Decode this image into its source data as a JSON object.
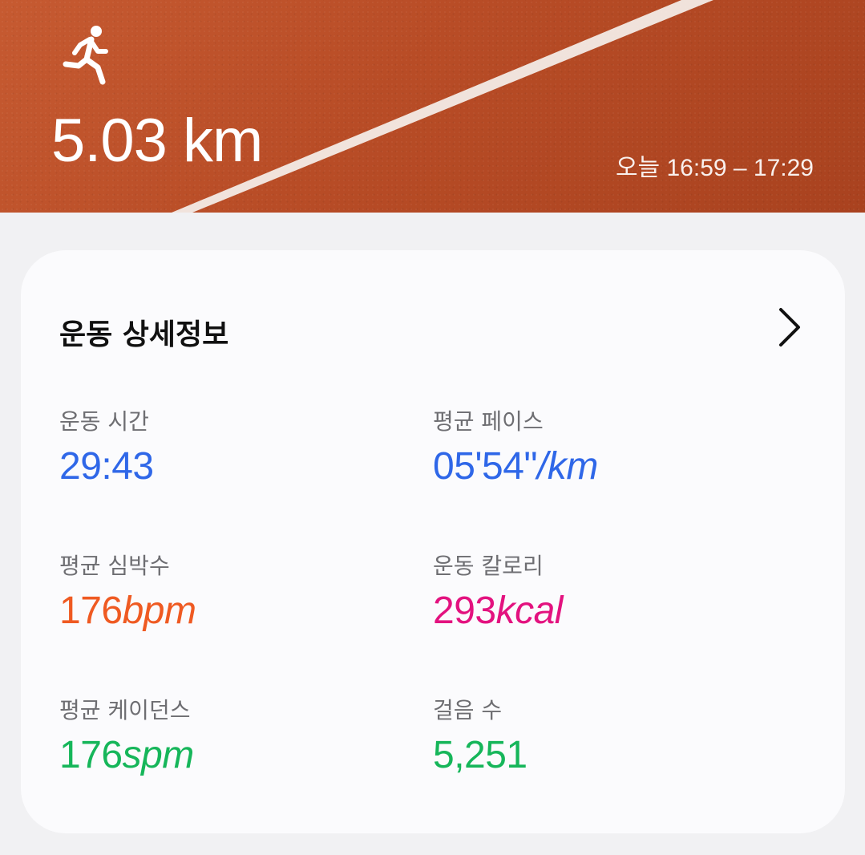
{
  "header": {
    "distance": "5.03 km",
    "time_range": "오늘 16:59 – 17:29",
    "icon": "runner-icon"
  },
  "details": {
    "title": "운동 상세정보",
    "more_icon": "chevron-right-icon",
    "stats": [
      {
        "label": "운동 시간",
        "value": "29:43",
        "unit": "",
        "color": "#2f67e8"
      },
      {
        "label": "평균 페이스",
        "value": "05'54\"",
        "unit": "/km",
        "color": "#2f67e8"
      },
      {
        "label": "평균 심박수",
        "value": "176",
        "unit": "bpm",
        "color": "#ef5a22"
      },
      {
        "label": "운동 칼로리",
        "value": "293",
        "unit": "kcal",
        "color": "#e3127f"
      },
      {
        "label": "평균 케이던스",
        "value": "176",
        "unit": "spm",
        "color": "#16b65a"
      },
      {
        "label": "걸음 수",
        "value": "5,251",
        "unit": "",
        "color": "#16b65a"
      }
    ]
  }
}
